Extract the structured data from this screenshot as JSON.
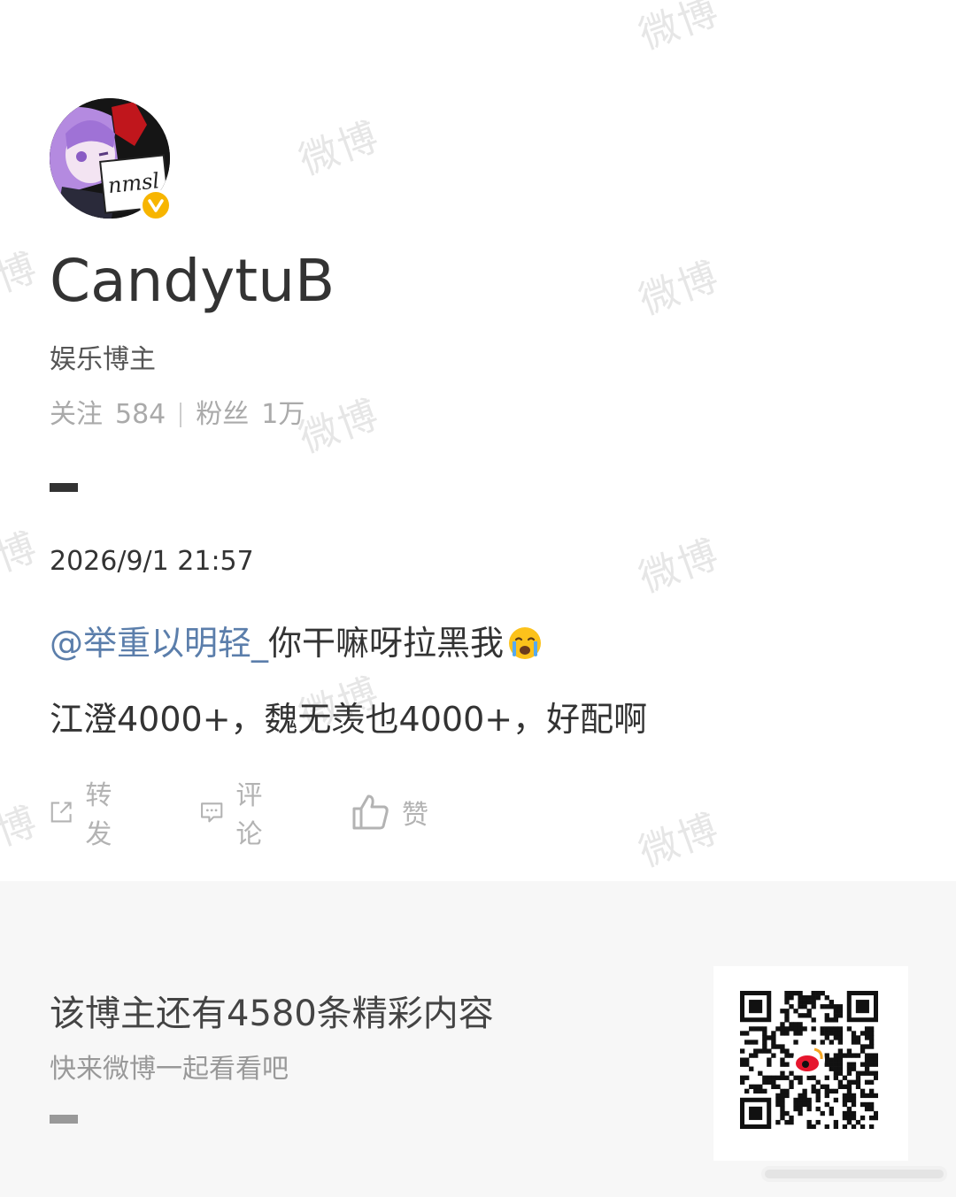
{
  "watermark": "微博",
  "profile": {
    "username": "CandytuB",
    "avatar_sign_text": "nmsl",
    "role": "娱乐博主",
    "following_label": "关注",
    "following_count": "584",
    "followers_label": "粉丝",
    "followers_count": "1万"
  },
  "post": {
    "date": "2026/9/1 21:57",
    "mention": "@举重以明轻_",
    "line1_text": " 你干嘛呀拉黑我",
    "line1_emoji": "crying-face-emoji",
    "line2_text": "江澄4000+，魏无羡也4000+，好配啊"
  },
  "actions": {
    "repost_label": "转发",
    "comment_label": "评论",
    "like_label": "赞"
  },
  "footer": {
    "more_text": "该博主还有4580条精彩内容",
    "sub_text": "快来微博一起看看吧",
    "qr_icon": "weibo-qr-code"
  },
  "colors": {
    "mention": "#5b7eab",
    "verified_badge": "#f7b500",
    "footer_bg": "#f7f7f7",
    "action_gray": "#b3b3b3"
  }
}
